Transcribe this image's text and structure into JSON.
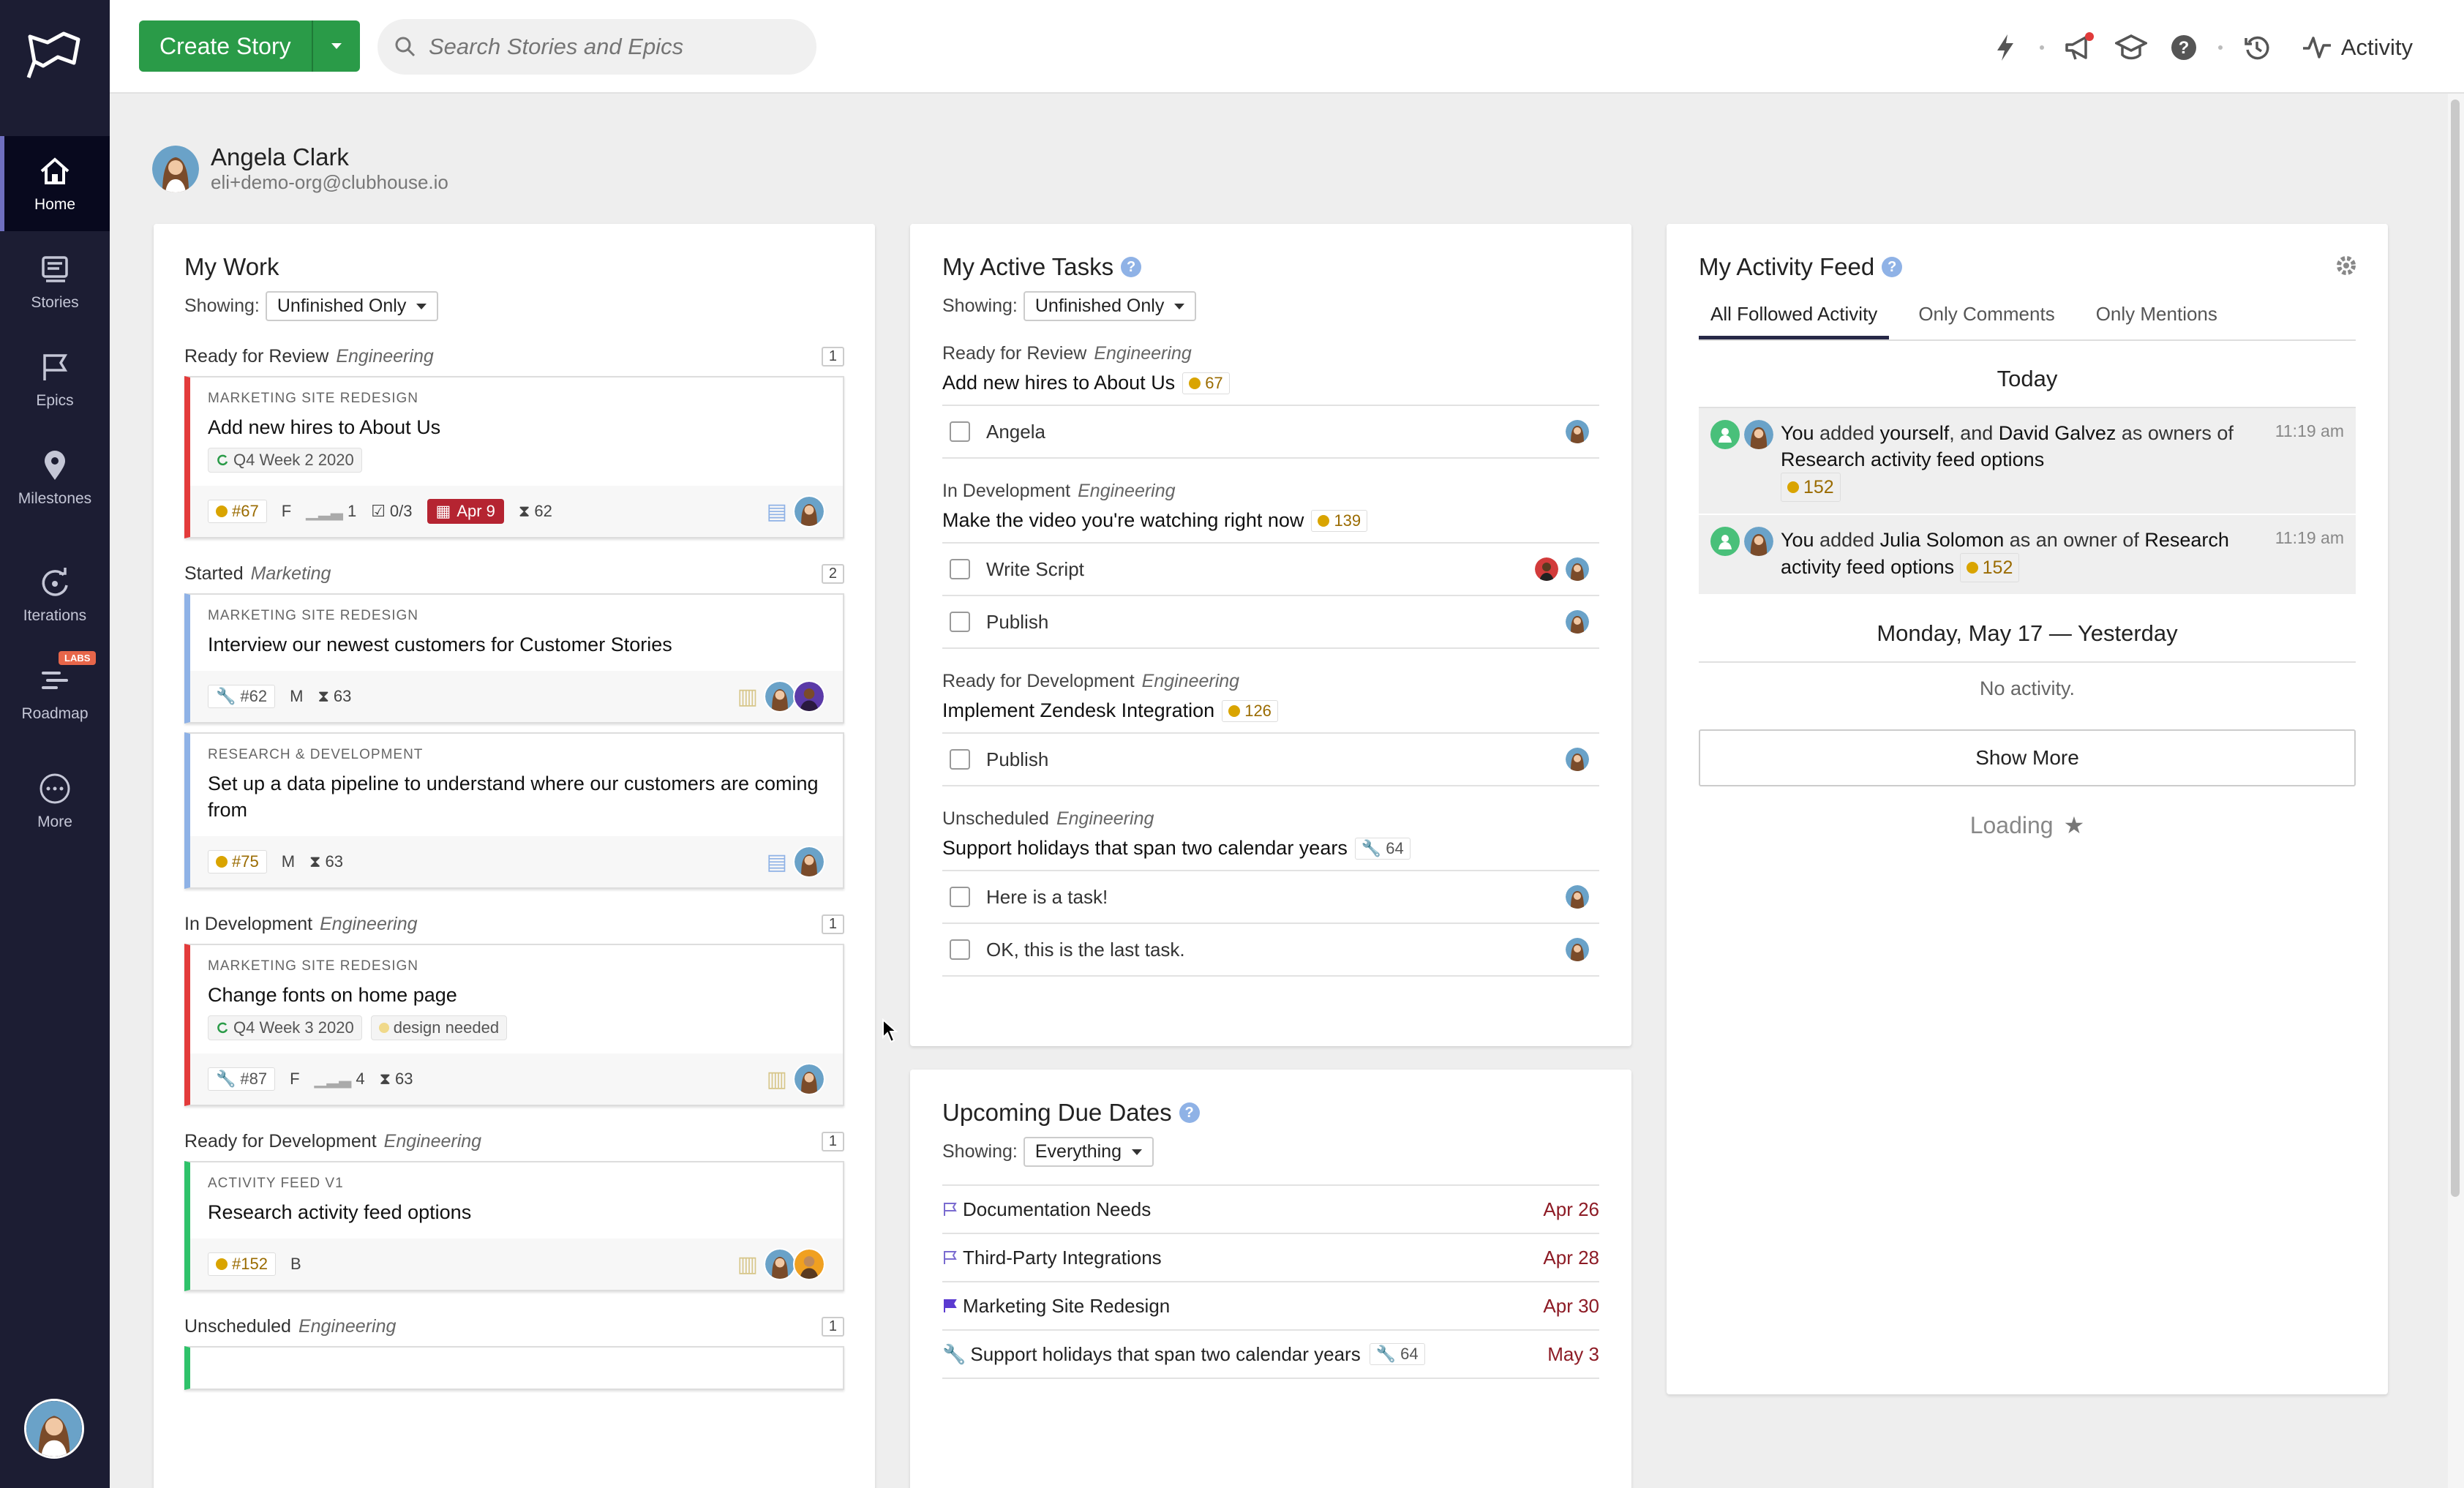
{
  "nav": {
    "items": [
      {
        "label": "Home"
      },
      {
        "label": "Stories"
      },
      {
        "label": "Epics"
      },
      {
        "label": "Milestones"
      },
      {
        "label": "Iterations"
      },
      {
        "label": "Roadmap",
        "badge": "LABS"
      },
      {
        "label": "More"
      }
    ]
  },
  "topbar": {
    "create_label": "Create Story",
    "search_placeholder": "Search Stories and Epics",
    "activity_label": "Activity"
  },
  "user": {
    "name": "Angela Clark",
    "email": "eli+demo-org@clubhouse.io"
  },
  "my_work": {
    "title": "My Work",
    "showing_label": "Showing:",
    "filter": "Unfinished Only",
    "groups": [
      {
        "state": "Ready for Review",
        "team": "Engineering",
        "count": "1",
        "stories": [
          {
            "epic": "MARKETING SITE REDESIGN",
            "title": "Add new hires to About Us",
            "label": "Q4 Week 2 2020",
            "id": "#67",
            "estimate": "F",
            "points": "1",
            "tasks": "0/3",
            "due": "Apr 9",
            "age": "62"
          }
        ]
      },
      {
        "state": "Started",
        "team": "Marketing",
        "count": "2",
        "stories": [
          {
            "epic": "MARKETING SITE REDESIGN",
            "title": "Interview our newest customers for Customer Stories",
            "id": "#62",
            "estimate": "M",
            "age": "63"
          },
          {
            "epic": "RESEARCH & DEVELOPMENT",
            "title": "Set up a data pipeline to understand where our customers are coming from",
            "id": "#75",
            "estimate": "M",
            "age": "63"
          }
        ]
      },
      {
        "state": "In Development",
        "team": "Engineering",
        "count": "1",
        "stories": [
          {
            "epic": "MARKETING SITE REDESIGN",
            "title": "Change fonts on home page",
            "label": "Q4 Week 3 2020",
            "label2": "design needed",
            "id": "#87",
            "estimate": "F",
            "points": "4",
            "age": "63"
          }
        ]
      },
      {
        "state": "Ready for Development",
        "team": "Engineering",
        "count": "1",
        "stories": [
          {
            "epic": "ACTIVITY FEED V1",
            "title": "Research activity feed options",
            "id": "#152",
            "estimate": "B"
          }
        ]
      },
      {
        "state": "Unscheduled",
        "team": "Engineering",
        "count": "1"
      }
    ]
  },
  "active_tasks": {
    "title": "My Active Tasks",
    "showing_label": "Showing:",
    "filter": "Unfinished Only",
    "stories": [
      {
        "state": "Ready for Review",
        "team": "Engineering",
        "name": "Add new hires to About Us",
        "id": "67",
        "tasks": [
          "Angela"
        ]
      },
      {
        "state": "In Development",
        "team": "Engineering",
        "name": "Make the video you're watching right now",
        "id": "139",
        "tasks": [
          "Write Script",
          "Publish"
        ]
      },
      {
        "state": "Ready for Development",
        "team": "Engineering",
        "name": "Implement Zendesk Integration",
        "id": "126",
        "tasks": [
          "Publish"
        ]
      },
      {
        "state": "Unscheduled",
        "team": "Engineering",
        "name": "Support holidays that span two calendar years",
        "id": "64",
        "tasks": [
          "Here is a task!",
          "OK, this is the last task."
        ]
      }
    ]
  },
  "due_dates": {
    "title": "Upcoming Due Dates",
    "showing_label": "Showing:",
    "filter": "Everything",
    "items": [
      {
        "name": "Documentation Needs",
        "date": "Apr 26"
      },
      {
        "name": "Third-Party Integrations",
        "date": "Apr 28"
      },
      {
        "name": "Marketing Site Redesign",
        "date": "Apr 30"
      },
      {
        "name": "Support holidays that span two calendar years",
        "id": "64",
        "date": "May 3"
      }
    ]
  },
  "activity_feed": {
    "title": "My Activity Feed",
    "tabs": [
      "All Followed Activity",
      "Only Comments",
      "Only Mentions"
    ],
    "today_label": "Today",
    "items": [
      {
        "you": "You",
        "t1": " added ",
        "b1": "yourself",
        "t2": ", and ",
        "b2": "David Galvez",
        "t3": " as owners of ",
        "b3": "Research activity feed options",
        "id": "152",
        "time": "11:19 am"
      },
      {
        "you": "You",
        "t1": " added ",
        "b1": "Julia Solomon",
        "t2": " as an owner of ",
        "b2": "Research activity feed options",
        "id": "152",
        "time": "11:19 am"
      }
    ],
    "yesterday_label": "Monday, May 17 — Yesterday",
    "no_activity": "No activity.",
    "show_more": "Show More",
    "loading": "Loading"
  }
}
